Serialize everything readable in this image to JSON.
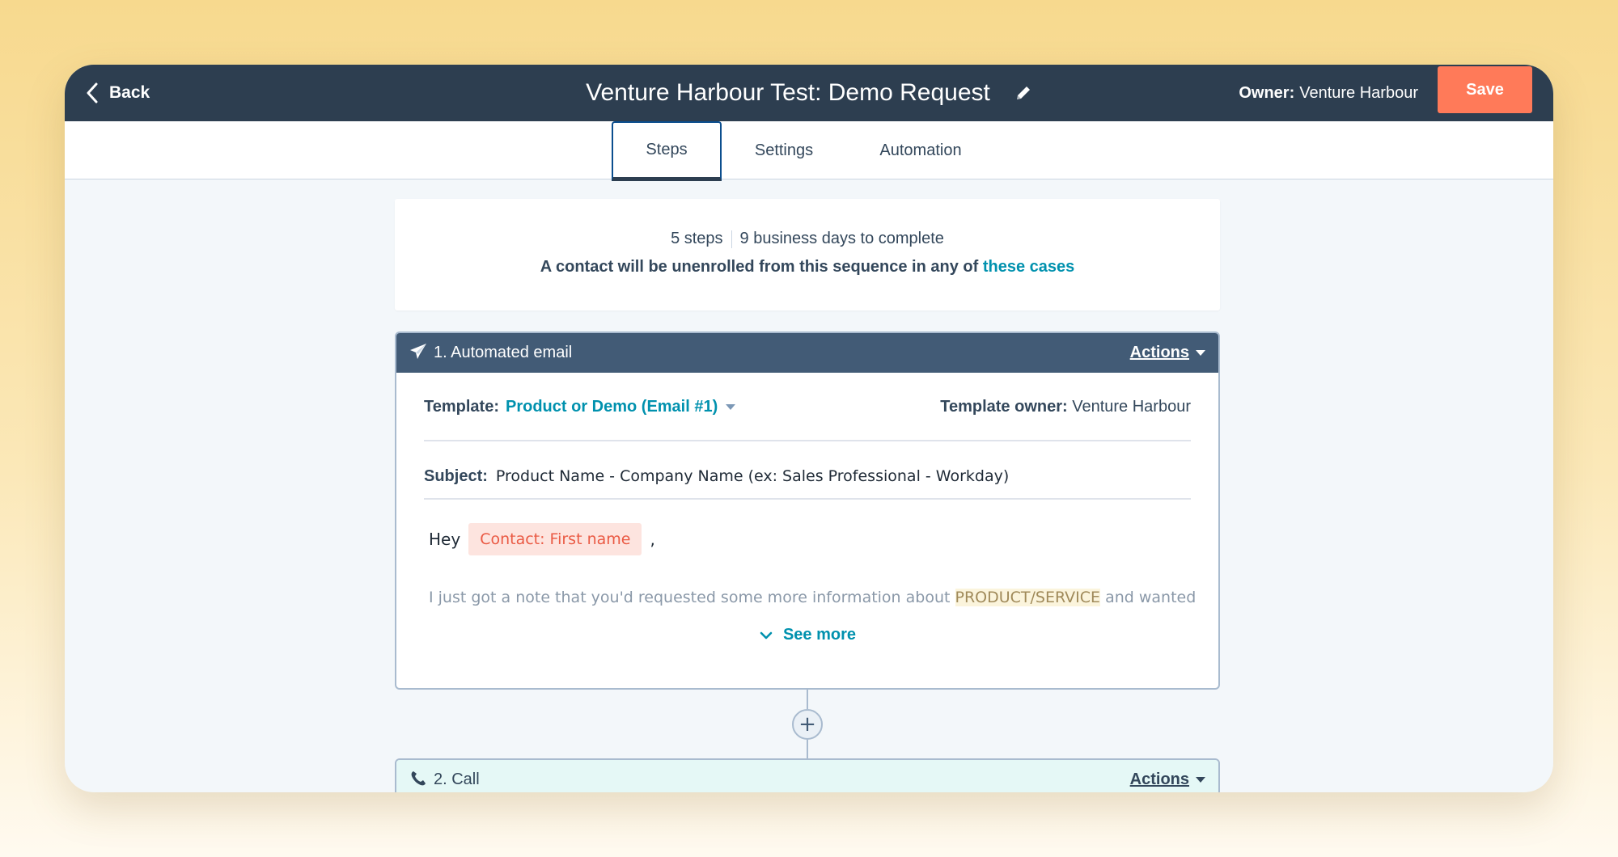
{
  "header": {
    "back_label": "Back",
    "title": "Venture Harbour Test: Demo Request",
    "owner_label": "Owner:",
    "owner_value": "Venture Harbour",
    "save_label": "Save"
  },
  "tabs": [
    {
      "label": "Steps",
      "active": true
    },
    {
      "label": "Settings",
      "active": false
    },
    {
      "label": "Automation",
      "active": false
    }
  ],
  "summary": {
    "steps": "5 steps",
    "duration": "9 business days to complete",
    "unenroll_text": "A contact will be unenrolled from this sequence in any of ",
    "unenroll_link": "these cases"
  },
  "step1": {
    "title": "1. Automated email",
    "actions_label": "Actions",
    "template_label": "Template:",
    "template_value": "Product or Demo (Email #1)",
    "template_owner_label": "Template owner:",
    "template_owner_value": "Venture Harbour",
    "subject_label": "Subject:",
    "subject_value": "Product Name - Company Name (ex: Sales Professional - Workday)",
    "greeting": "Hey",
    "token": "Contact: First name",
    "comma": ",",
    "body_pre": "I just got a note that you'd requested some more information about ",
    "body_highlight": "PRODUCT/SERVICE",
    "body_post": " and wanted",
    "see_more_label": "See more"
  },
  "step2": {
    "title": "2. Call",
    "actions_label": "Actions"
  },
  "colors": {
    "header_bg": "#2d3e50",
    "save_bg": "#ff7a59",
    "step_header_bg": "#425b76",
    "link": "#0091ae",
    "token_bg": "#fde4df",
    "token_text": "#ea5a44",
    "call_bg": "#e5f8f6"
  },
  "icons": [
    "chevron-left-icon",
    "pencil-icon",
    "paper-plane-icon",
    "caret-down-icon",
    "chevron-down-icon",
    "plus-icon",
    "phone-icon"
  ]
}
